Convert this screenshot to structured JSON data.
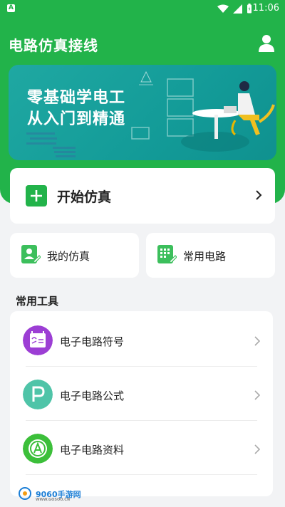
{
  "status_bar": {
    "notification_letter": "A",
    "time": "11:06"
  },
  "header": {
    "title": "电路仿真接线"
  },
  "banner": {
    "line1": "零基础学电工",
    "line2": "从入门到精通"
  },
  "start_card": {
    "label": "开始仿真"
  },
  "quick_actions": [
    {
      "label": "我的仿真"
    },
    {
      "label": "常用电路"
    }
  ],
  "tools_section": {
    "title": "常用工具",
    "items": [
      {
        "label": "电子电路符号",
        "color": "#9c3ed4"
      },
      {
        "label": "电子电路公式",
        "color": "#4fc4a8"
      },
      {
        "label": "电子电路资料",
        "color": "#3cbf3a"
      }
    ]
  },
  "colors": {
    "primary": "#22b34a",
    "banner": "#139b98"
  },
  "watermark": {
    "text": "9060手游网",
    "sub": "WWW.GOSOO.CN"
  }
}
